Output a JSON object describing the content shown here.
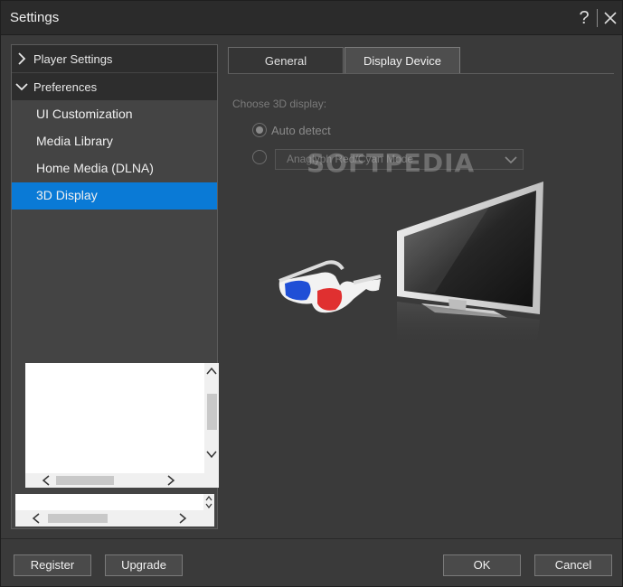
{
  "window": {
    "title": "Settings"
  },
  "sidebar": {
    "groups": [
      {
        "label": "Player Settings",
        "expanded": false
      },
      {
        "label": "Preferences",
        "expanded": true
      }
    ],
    "items": [
      {
        "label": "UI Customization"
      },
      {
        "label": "Media Library"
      },
      {
        "label": "Home Media (DLNA)"
      },
      {
        "label": "3D Display",
        "selected": true
      }
    ]
  },
  "tabs": [
    {
      "label": "General",
      "active": false
    },
    {
      "label": "Display Device",
      "active": true
    }
  ],
  "display": {
    "choose_label": "Choose 3D display:",
    "auto_detect_label": "Auto detect",
    "mode_value": "Anaglyph Red/Cyan Mode",
    "watermark": "SOFTPEDIA"
  },
  "footer": {
    "register_label": "Register",
    "upgrade_label": "Upgrade",
    "ok_label": "OK",
    "cancel_label": "Cancel"
  },
  "colors": {
    "accent": "#0a7ad6",
    "background": "#3a3a3a",
    "titlebar": "#2b2b2b"
  },
  "icons": [
    "help-icon",
    "close-icon",
    "chevron-right-icon",
    "chevron-down-icon",
    "dropdown-arrow-icon",
    "glasses-icon",
    "monitor-icon"
  ]
}
